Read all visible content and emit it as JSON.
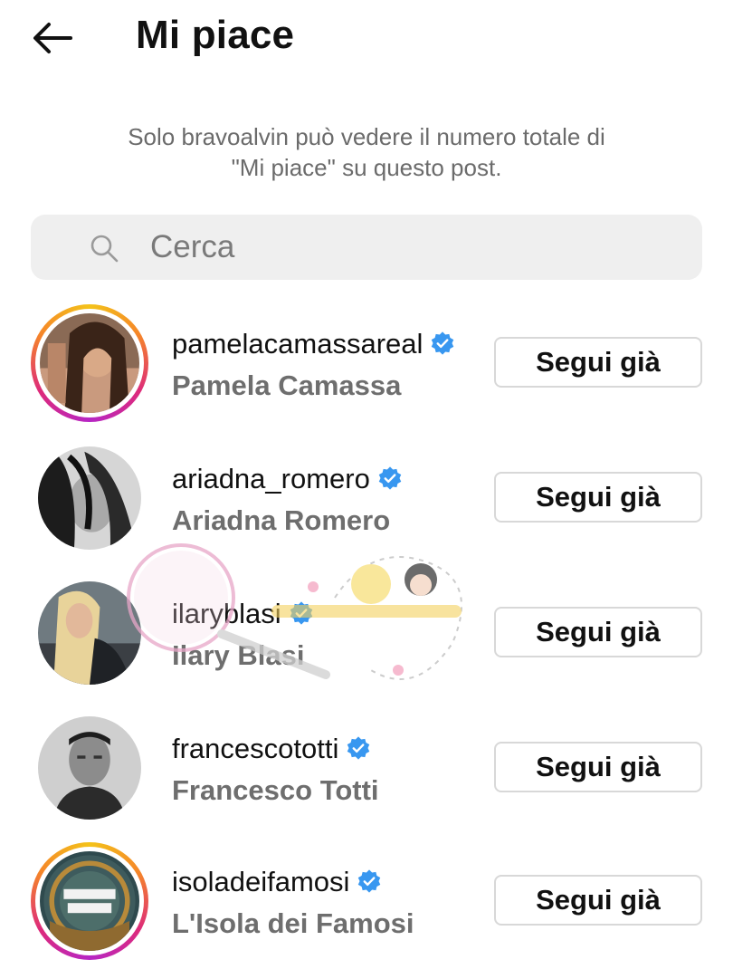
{
  "header": {
    "title": "Mi piace",
    "back_icon": "arrow-left-icon"
  },
  "notice": {
    "line1": "Solo bravoalvin può vedere il numero totale di",
    "line2": "\"Mi piace\" su questo post."
  },
  "search": {
    "placeholder": "Cerca",
    "value": "",
    "icon": "search-icon"
  },
  "users": [
    {
      "username": "pamelacamassareal",
      "full_name": "Pamela Camassa",
      "verified": true,
      "story_ring": true,
      "button": "Segui già"
    },
    {
      "username": "ariadna_romero",
      "full_name": "Ariadna Romero",
      "verified": true,
      "story_ring": false,
      "button": "Segui già"
    },
    {
      "username": "ilaryblasi",
      "full_name": "Ilary Blasi",
      "verified": true,
      "story_ring": false,
      "button": "Segui già"
    },
    {
      "username": "francescototti",
      "full_name": "Francesco Totti",
      "verified": true,
      "story_ring": false,
      "button": "Segui già"
    },
    {
      "username": "isoladeifamosi",
      "full_name": "L'Isola dei Famosi",
      "verified": true,
      "story_ring": true,
      "button": "Segui già"
    }
  ],
  "colors": {
    "verified": "#3897f0",
    "secondary_text": "#6e6e6e",
    "search_bg": "#efefef",
    "button_border": "#d8d8d8"
  }
}
